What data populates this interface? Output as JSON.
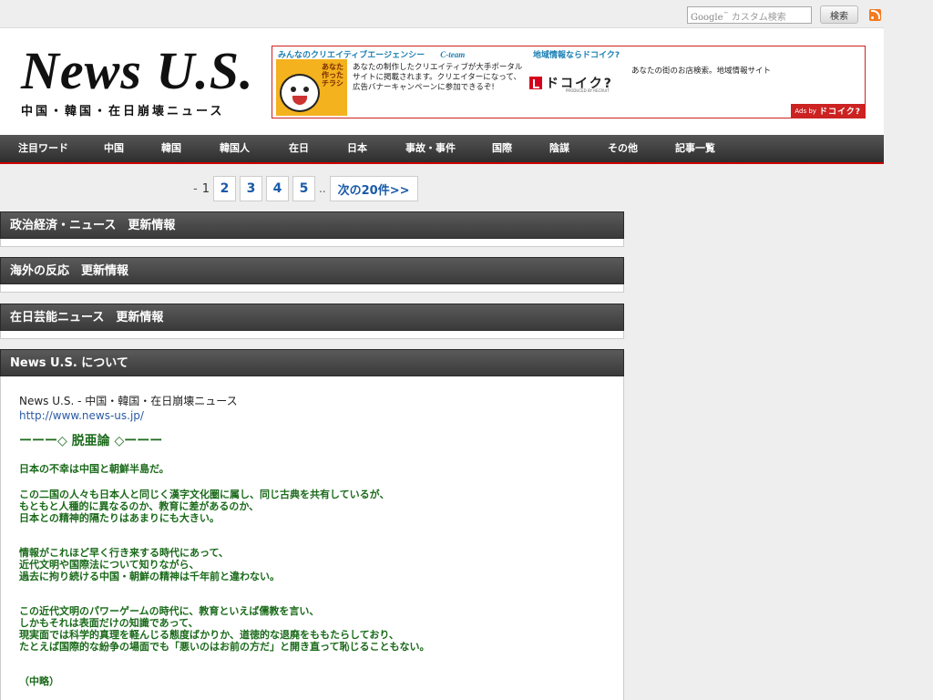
{
  "search": {
    "google_mark": "Google",
    "placeholder_text": "カスタム検索",
    "button_label": "検索"
  },
  "header": {
    "logo_title": "News U.S.",
    "logo_subtitle": "中国・韓国・在日崩壊ニュース"
  },
  "ad": {
    "left_heading": "みんなのクリエイティブエージェンシー",
    "left_brand": "C-team",
    "left_image_text": "あなた作ったチラシ",
    "left_text": "あなたの制作したクリエイティブが大手ポータルサイトに掲載されます。クリエイターになって、広告バナーキャンペーンに参加できるぞ!",
    "mid_heading": "地域情報ならドコイク?",
    "mid_logo": "ドコイク?",
    "mid_logo_sub": "PRODUCED BY RECRUIT",
    "right_text": "あなたの街のお店検索。地域情報サイト",
    "footer_prefix": "Ads by",
    "footer_brand": "ドコイク?"
  },
  "nav": [
    {
      "label": "注目ワード"
    },
    {
      "label": "中国"
    },
    {
      "label": "韓国"
    },
    {
      "label": "韓国人"
    },
    {
      "label": "在日"
    },
    {
      "label": "日本"
    },
    {
      "label": "事故・事件"
    },
    {
      "label": "国際"
    },
    {
      "label": "陰謀"
    },
    {
      "label": "その他"
    },
    {
      "label": "記事一覧"
    }
  ],
  "pager": {
    "prefix": "-",
    "current": "1",
    "pages": [
      "2",
      "3",
      "4",
      "5"
    ],
    "ellipsis": "..",
    "next_label": "次の20件>>"
  },
  "sections": [
    {
      "title": "政治経済・ニュース　更新情報"
    },
    {
      "title": "海外の反応　更新情報"
    },
    {
      "title": "在日芸能ニュース　更新情報"
    }
  ],
  "about": {
    "title": "News U.S. について",
    "site_name": "News U.S. - 中国・韓国・在日崩壊ニュース",
    "url": "http://www.news-us.jp/",
    "motto": "ーーー◇ 脱亜論 ◇ーーー",
    "para1": [
      "日本の不幸は中国と朝鮮半島だ。"
    ],
    "para2": [
      "この二国の人々も日本人と同じく漢字文化圏に属し、同じ古典を共有しているが、",
      "もともと人種的に異なるのか、教育に差があるのか、",
      "日本との精神的隔たりはあまりにも大きい。"
    ],
    "para3": [
      "情報がこれほど早く行き来する時代にあって、",
      "近代文明や国際法について知りながら、",
      "過去に拘り続ける中国・朝鮮の精神は千年前と違わない。"
    ],
    "para4": [
      "この近代文明のパワーゲームの時代に、教育といえば儒教を言い、",
      "しかもそれは表面だけの知識であって、",
      "現実面では科学的真理を軽んじる態度ばかりか、道徳的な退廃をももたらしており、",
      "たとえば国際的な紛争の場面でも「悪いのはお前の方だ」と開き直って恥じることもない。"
    ],
    "para5": [
      "（中略）"
    ]
  }
}
